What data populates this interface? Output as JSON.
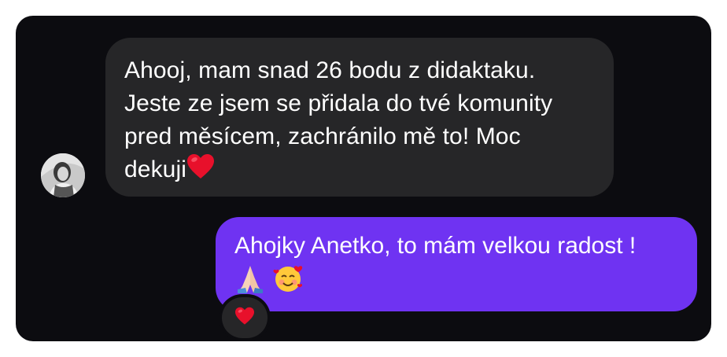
{
  "chat": {
    "incoming": {
      "lines": [
        "Ahooj, mam snad 26 bodu z didaktaku.",
        "Jeste ze jsem se přidala do tvé komunity",
        "pred měsícem, zachránilo mě to! Moc",
        "dekuji"
      ],
      "trailing_emoji": "red-heart-icon"
    },
    "outgoing": {
      "lines": [
        "Ahojky Anetko, to mám velkou radost !"
      ],
      "emojis": [
        "folded-hands-icon",
        "smiling-face-with-hearts-icon"
      ]
    },
    "reaction": {
      "emoji": "red-heart-icon"
    }
  },
  "colors": {
    "panel_bg": "#0c0c10",
    "incoming_bubble": "#262628",
    "outgoing_bubble": "#6f33f2",
    "text": "#ffffff",
    "heart": "#e8102b"
  }
}
